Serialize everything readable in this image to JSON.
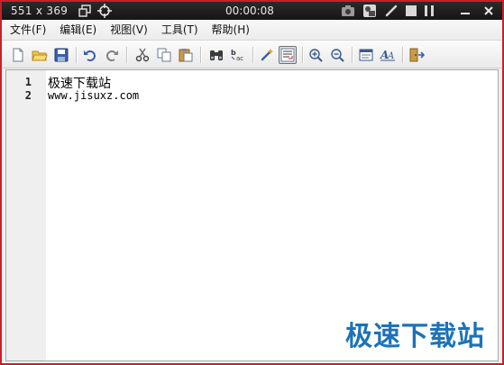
{
  "recorder": {
    "size_label": "551 x 369",
    "timer": "00:00:08",
    "icons": [
      "restore-window-icon",
      "crosshair-icon",
      "camera-icon",
      "webcam-icon",
      "pen-icon",
      "stop-icon",
      "pause-icon",
      "minimize-icon",
      "close-icon"
    ]
  },
  "menu": {
    "items": [
      {
        "label": "文件(F)"
      },
      {
        "label": "编辑(E)"
      },
      {
        "label": "视图(V)"
      },
      {
        "label": "工具(T)"
      },
      {
        "label": "帮助(H)"
      }
    ]
  },
  "toolbar": {
    "buttons": [
      "new-file",
      "open-file",
      "save",
      "undo",
      "redo",
      "cut",
      "copy",
      "paste",
      "find",
      "replace",
      "highlight",
      "word-wrap",
      "zoom-in",
      "zoom-out",
      "properties",
      "font",
      "exit"
    ]
  },
  "editor": {
    "lines": [
      {
        "num": "1",
        "text": "极速下载站"
      },
      {
        "num": "2",
        "text": "www.jisuxz.com"
      }
    ]
  },
  "watermark": {
    "text": "极速下载站"
  },
  "colors": {
    "frame_border": "#c8202a",
    "watermark": "#1d72b8",
    "recorder_bar": "#1a1a1a"
  }
}
